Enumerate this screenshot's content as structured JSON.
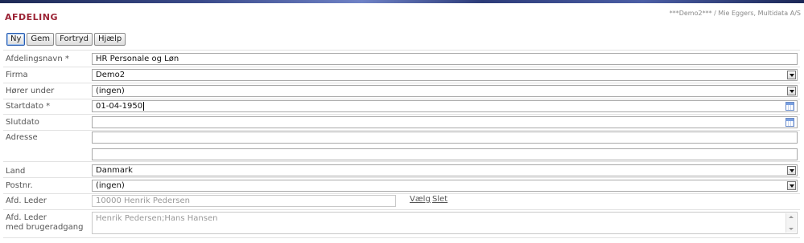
{
  "header": {
    "title": "AFDELING",
    "user_info": "***Demo2*** / Mie Eggers, Multidata A/S"
  },
  "toolbar": {
    "new_label": "Ny",
    "save_label": "Gem",
    "cancel_label": "Fortryd",
    "help_label": "Hjælp"
  },
  "form": {
    "department_name": {
      "label": "Afdelingsnavn *",
      "value": "HR Personale og Løn"
    },
    "company": {
      "label": "Firma",
      "value": "Demo2"
    },
    "belongs_to": {
      "label": "Hører under",
      "value": "(ingen)"
    },
    "start_date": {
      "label": "Startdato *",
      "value": "01-04-1950"
    },
    "end_date": {
      "label": "Slutdato",
      "value": ""
    },
    "address": {
      "label": "Adresse",
      "line1": "",
      "line2": ""
    },
    "country": {
      "label": "Land",
      "value": "Danmark"
    },
    "postal_code": {
      "label": "Postnr.",
      "value": "(ingen)"
    },
    "manager": {
      "label": "Afd. Leder",
      "value": "10000 Henrik Pedersen",
      "choose_link": "Vælg",
      "delete_link": "Slet"
    },
    "manager_access": {
      "label_line1": "Afd. Leder",
      "label_line2": "med brugeradgang",
      "value": "Henrik Pedersen;Hans Hansen"
    }
  },
  "icons": {
    "dropdown": "chevron-down-icon",
    "calendar": "calendar-icon",
    "scroll_up": "scroll-up-icon",
    "scroll_down": "scroll-down-icon"
  },
  "colors": {
    "title": "#9b2335",
    "header_bar": "#2c3b78",
    "text": "#333333",
    "readonly_text": "#999999"
  }
}
